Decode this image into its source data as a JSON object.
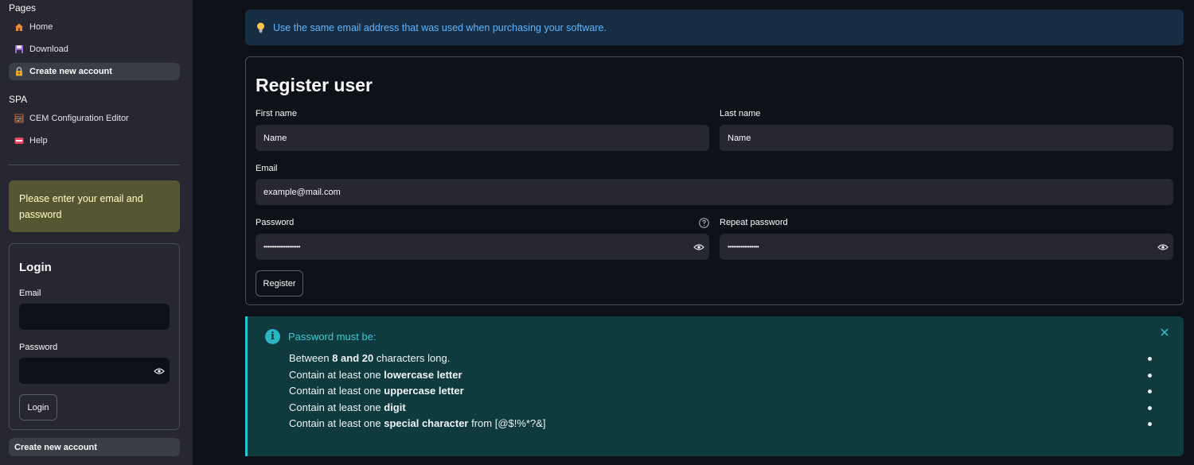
{
  "sidebar": {
    "pages_header": "Pages",
    "pages": [
      {
        "label": "Home",
        "icon": "house-icon"
      },
      {
        "label": "Download",
        "icon": "floppy-disk-icon"
      },
      {
        "label": "Create new account",
        "icon": "locked-with-key-icon"
      }
    ],
    "spa_header": "SPA",
    "spa_pages": [
      {
        "label": "CEM Configuration Editor",
        "icon": "abacus-icon"
      },
      {
        "label": "Help",
        "icon": "sos-icon"
      }
    ],
    "warning": "Please enter your email and password",
    "login": {
      "title": "Login",
      "email_label": "Email",
      "password_label": "Password",
      "button": "Login"
    },
    "create_account_button": "Create new account"
  },
  "main": {
    "info": "Use the same email address that was used when purchasing your software.",
    "register": {
      "title": "Register user",
      "first_name_label": "First name",
      "first_name_value": "Name",
      "last_name_label": "Last name",
      "last_name_value": "Name",
      "email_label": "Email",
      "email_value": "example@mail.com",
      "password_label": "Password",
      "password_value": "••••••••••••••••••••",
      "repeat_password_label": "Repeat password",
      "repeat_password_value": "•••••••••••••••••",
      "button": "Register"
    },
    "password_rules": {
      "heading": "Password must be:",
      "rules": [
        {
          "pre": "Between ",
          "bold": "8 and 20",
          "post": " characters long."
        },
        {
          "pre": "Contain at least one ",
          "bold": "lowercase letter",
          "post": ""
        },
        {
          "pre": "Contain at least one ",
          "bold": "uppercase letter",
          "post": ""
        },
        {
          "pre": "Contain at least one ",
          "bold": "digit",
          "post": ""
        },
        {
          "pre": "Contain at least one ",
          "bold": "special character",
          "post": " from [@$!%*?&]"
        }
      ]
    }
  },
  "colors": {
    "background": "#0e1117",
    "sidebar": "#262730",
    "info_bg": "#172d43",
    "info_text": "#60b4ff",
    "warning_bg": "#575632",
    "rules_bg": "#0f3a3e",
    "rules_accent": "#21c4d1"
  }
}
